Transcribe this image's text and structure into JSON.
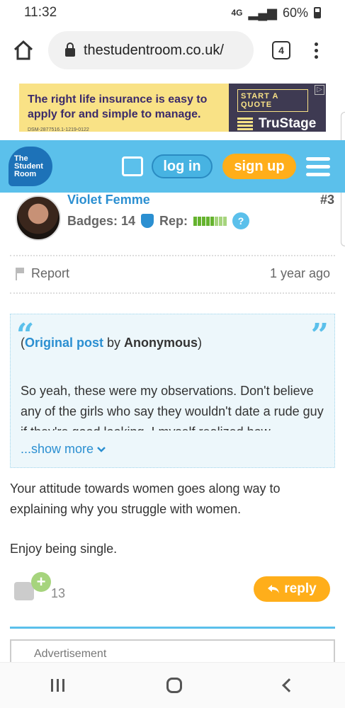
{
  "status": {
    "time": "11:32",
    "network": "4G",
    "battery": "60%"
  },
  "browser": {
    "url": "thestudentroom.co.uk/",
    "tab_count": "4"
  },
  "ad_top": {
    "headline": "The right life insurance is easy to apply for and simple to manage.",
    "fineprint": "DSM-2877516.1-1219-0122",
    "cta": "START A QUOTE",
    "brand": "TruStage"
  },
  "site": {
    "logo_text": "The Student Room",
    "login_label": "log in",
    "signup_label": "sign up",
    "colors": {
      "header": "#5bc0eb",
      "signup": "#ffae1a",
      "link": "#2b8fd1"
    }
  },
  "post": {
    "username": "Violet Femme",
    "post_number": "#3",
    "badges_label": "Badges: 14",
    "rep_label": "Rep:",
    "help": "?",
    "report_label": "Report",
    "timestamp": "1 year ago",
    "quote": {
      "open_paren": "(",
      "original_post": "Original post",
      "by": " by ",
      "author": "Anonymous",
      "close_paren": ")",
      "body": "So yeah, these were my observations. Don't believe any of the girls who say they wouldn't date a rude guy if they're good looking. I myself realized how",
      "show_more": "...show more"
    },
    "reply_line1": "Your attitude towards women goes along way to explaining why you struggle with women.",
    "reply_line2": "Enjoy being single.",
    "likes": "13",
    "reply_button": "reply"
  },
  "ad_bottom": {
    "label": "Advertisement"
  }
}
